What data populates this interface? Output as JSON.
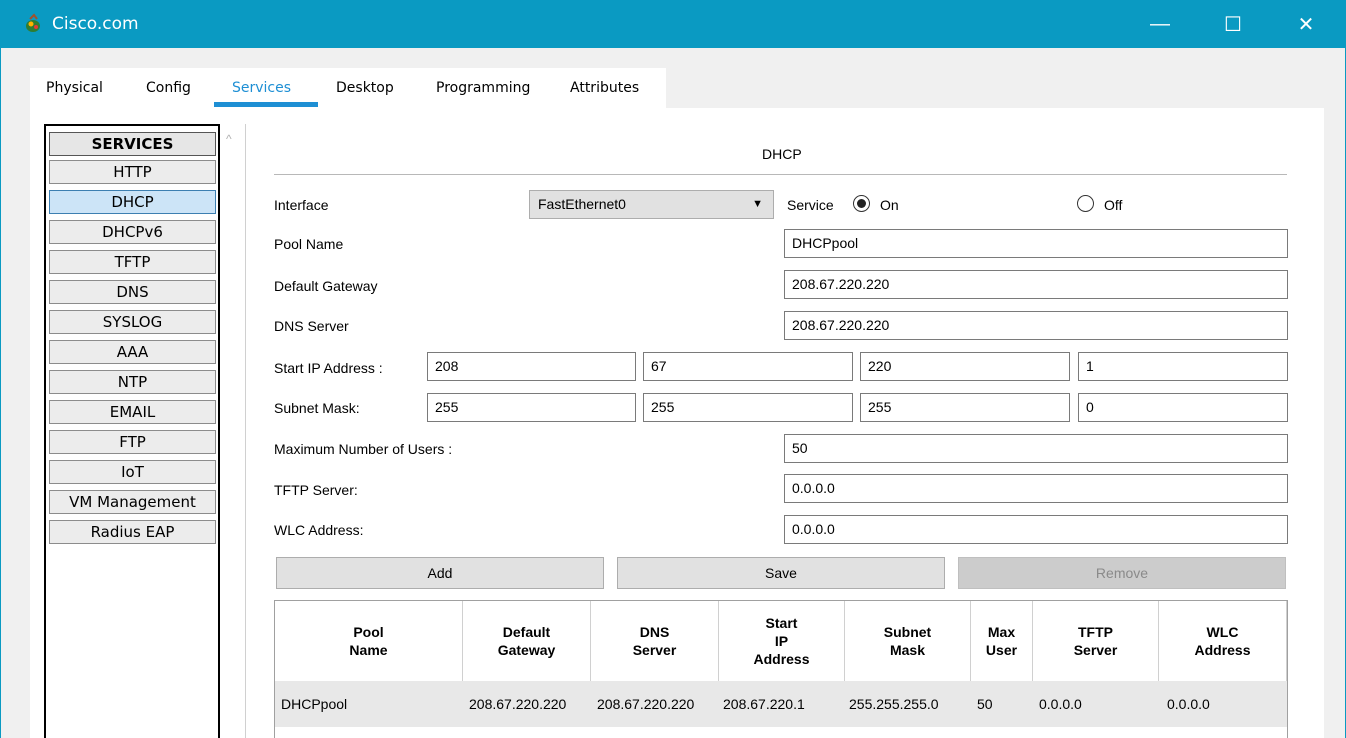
{
  "window": {
    "title": "Cisco.com",
    "minimize": "—",
    "maximize": "☐",
    "close": "✕"
  },
  "tabs": [
    {
      "label": "Physical"
    },
    {
      "label": "Config"
    },
    {
      "label": "Services",
      "active": true
    },
    {
      "label": "Desktop"
    },
    {
      "label": "Programming"
    },
    {
      "label": "Attributes"
    }
  ],
  "sidebar": {
    "header": "SERVICES",
    "items": [
      {
        "label": "HTTP"
      },
      {
        "label": "DHCP",
        "selected": true
      },
      {
        "label": "DHCPv6"
      },
      {
        "label": "TFTP"
      },
      {
        "label": "DNS"
      },
      {
        "label": "SYSLOG"
      },
      {
        "label": "AAA"
      },
      {
        "label": "NTP"
      },
      {
        "label": "EMAIL"
      },
      {
        "label": "FTP"
      },
      {
        "label": "IoT"
      },
      {
        "label": "VM Management"
      },
      {
        "label": "Radius EAP"
      }
    ],
    "scroll_up": "^"
  },
  "form": {
    "section_title": "DHCP",
    "interface_label": "Interface",
    "interface_value": "FastEthernet0",
    "service_label": "Service",
    "on_label": "On",
    "off_label": "Off",
    "service_state": "On",
    "pool_name_label": "Pool Name",
    "pool_name_value": "DHCPpool",
    "default_gateway_label": "Default Gateway",
    "default_gateway_value": "208.67.220.220",
    "dns_server_label": "DNS Server",
    "dns_server_value": "208.67.220.220",
    "start_ip_label": "Start IP Address :",
    "start_ip": [
      "208",
      "67",
      "220",
      "1"
    ],
    "subnet_mask_label": "Subnet Mask:",
    "subnet_mask": [
      "255",
      "255",
      "255",
      "0"
    ],
    "max_users_label": "Maximum Number of Users :",
    "max_users_value": "50",
    "tftp_server_label": "TFTP Server:",
    "tftp_server_value": "0.0.0.0",
    "wlc_address_label": "WLC Address:",
    "wlc_address_value": "0.0.0.0"
  },
  "buttons": {
    "add": "Add",
    "save": "Save",
    "remove": "Remove"
  },
  "table": {
    "headers": [
      "Pool\nName",
      "Default\nGateway",
      "DNS\nServer",
      "Start\nIP\nAddress",
      "Subnet\nMask",
      "Max\nUser",
      "TFTP\nServer",
      "WLC\nAddress"
    ],
    "rows": [
      [
        "DHCPpool",
        "208.67.220.220",
        "208.67.220.220",
        "208.67.220.1",
        "255.255.255.0",
        "50",
        "0.0.0.0",
        "0.0.0.0"
      ]
    ]
  }
}
